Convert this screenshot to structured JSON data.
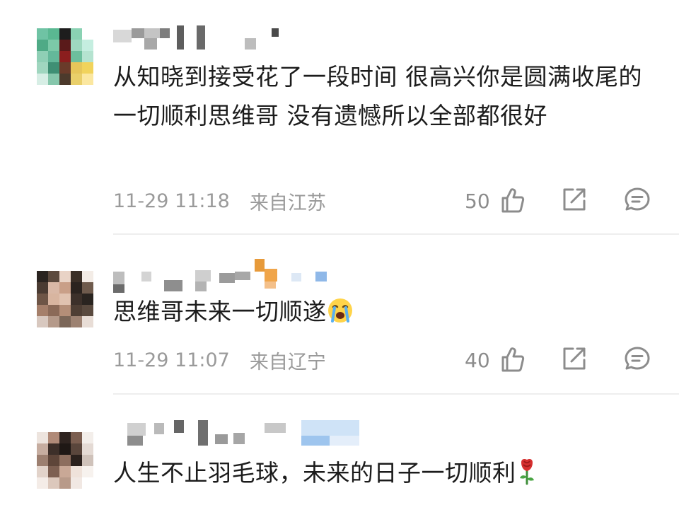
{
  "comments": [
    {
      "text": "从知晓到接受花了一段时间 很高兴你是圆满收尾的 一切顺利思维哥 没有遗憾所以全部都很好",
      "time": "11-29 11:18",
      "location": "来自江苏",
      "likes": "50"
    },
    {
      "text": "思维哥未来一切顺遂",
      "emoji": "crying-face",
      "time": "11-29 11:07",
      "location": "来自辽宁",
      "likes": "40"
    },
    {
      "text": "人生不止羽毛球，未来的日子一切顺利",
      "emoji": "rose"
    }
  ],
  "icons": {
    "like": "thumbs-up-icon",
    "share": "share-icon",
    "reply": "comment-icon"
  },
  "colors": {
    "meta_text": "#9a9a9a",
    "body_text": "#1c1c1c",
    "icon": "#8c8c8c"
  }
}
